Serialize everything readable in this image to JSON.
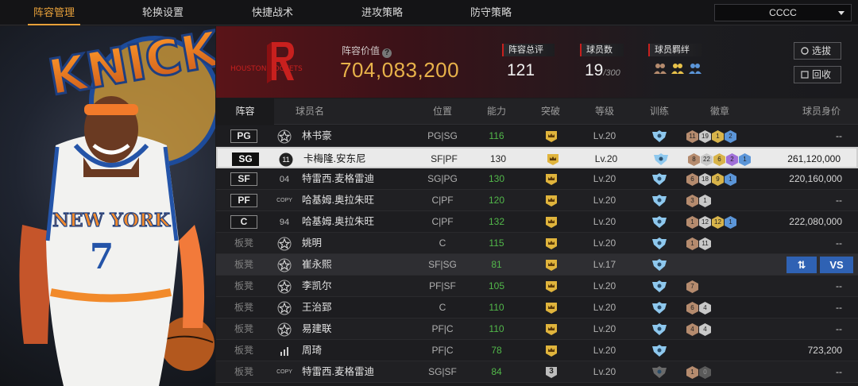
{
  "nav": {
    "tabs": [
      "阵容管理",
      "轮换设置",
      "快捷战术",
      "进攻策略",
      "防守策略"
    ],
    "active_tab": "阵容管理",
    "dropdown_value": "CCCC"
  },
  "team": {
    "logo_text": "HOUSTON ROCKETS",
    "value_label": "阵容价值",
    "value": "704,083,200",
    "rating_label": "阵容总评",
    "rating": "121",
    "players_label": "球员数",
    "players_count": "19",
    "players_max": "/300",
    "chem_label": "球员羁绊",
    "select_button": "选拔",
    "recycle_button": "回收"
  },
  "player_card": {
    "jersey_team": "NEW YORK",
    "jersey_number": "7",
    "bg_logo": "KNICKS"
  },
  "colors": {
    "accent": "#e8a13a",
    "value_gold": "#e8b24a",
    "red": "#c8201e",
    "blue_btn": "#2f62b4",
    "green_text": "#52b84a"
  },
  "table": {
    "headers": [
      "阵容",
      "球员名",
      "位置",
      "能力",
      "突破",
      "等级",
      "训练",
      "徽章",
      "球员身价"
    ],
    "rows": [
      {
        "slot": "PG",
        "type": "starter",
        "badge": "star-icon",
        "name": "林书豪",
        "position": "PG|SG",
        "rating": "116",
        "breakthrough": "crown",
        "level": "Lv.20",
        "medals": [
          [
            "b",
            "11"
          ],
          [
            "s",
            "19"
          ],
          [
            "g",
            "1"
          ],
          [
            "bl",
            "2"
          ]
        ],
        "price": "--"
      },
      {
        "slot": "SG",
        "type": "starter",
        "badge": "dark-circle-icon",
        "badge_text": "11",
        "name": "卡梅隆.安东尼",
        "position": "SF|PF",
        "rating": "130",
        "breakthrough": "crown",
        "level": "Lv.20",
        "medals": [
          [
            "b",
            "8"
          ],
          [
            "s",
            "22"
          ],
          [
            "g",
            "6"
          ],
          [
            "p",
            "2"
          ],
          [
            "bl",
            "1"
          ]
        ],
        "price": "261,120,000"
      },
      {
        "slot": "SF",
        "type": "starter",
        "badge": "year-04",
        "badge_text": "04",
        "name": "特雷西.麦格雷迪",
        "position": "SG|PG",
        "rating": "130",
        "breakthrough": "crown",
        "level": "Lv.20",
        "medals": [
          [
            "b",
            "6"
          ],
          [
            "s",
            "18"
          ],
          [
            "g",
            "9"
          ],
          [
            "bl",
            "1"
          ]
        ],
        "price": "220,160,000"
      },
      {
        "slot": "PF",
        "type": "starter",
        "badge": "copy",
        "badge_text": "COPY",
        "name": "哈基姆.奥拉朱旺",
        "position": "C|PF",
        "rating": "120",
        "breakthrough": "crown",
        "level": "Lv.20",
        "medals": [
          [
            "b",
            "3"
          ],
          [
            "s",
            "1"
          ]
        ],
        "price": "--"
      },
      {
        "slot": "C",
        "type": "starter",
        "badge": "year-94",
        "badge_text": "94",
        "name": "哈基姆.奥拉朱旺",
        "position": "C|PF",
        "rating": "132",
        "breakthrough": "crown",
        "level": "Lv.20",
        "medals": [
          [
            "b",
            "1"
          ],
          [
            "s",
            "12"
          ],
          [
            "g",
            "12"
          ],
          [
            "bl",
            "1"
          ]
        ],
        "price": "222,080,000"
      },
      {
        "slot": "板凳",
        "type": "bench",
        "badge": "star-icon",
        "name": "姚明",
        "position": "C",
        "rating": "115",
        "breakthrough": "crown",
        "level": "Lv.20",
        "medals": [
          [
            "b",
            "1"
          ],
          [
            "s",
            "11"
          ]
        ],
        "price": "--"
      },
      {
        "slot": "板凳",
        "type": "bench",
        "badge": "star-icon",
        "name": "崔永熙",
        "position": "SF|SG",
        "rating": "81",
        "breakthrough": "crown",
        "level": "Lv.17",
        "medals": [],
        "price": "",
        "actions": true
      },
      {
        "slot": "板凳",
        "type": "bench",
        "badge": "star-icon",
        "name": "李凯尔",
        "position": "PF|SF",
        "rating": "105",
        "breakthrough": "crown",
        "level": "Lv.20",
        "medals": [
          [
            "b",
            "7"
          ]
        ],
        "price": "--"
      },
      {
        "slot": "板凳",
        "type": "bench",
        "badge": "star-icon",
        "name": "王治郅",
        "position": "C",
        "rating": "110",
        "breakthrough": "crown",
        "level": "Lv.20",
        "medals": [
          [
            "b",
            "6"
          ],
          [
            "s",
            "4"
          ]
        ],
        "price": "--"
      },
      {
        "slot": "板凳",
        "type": "bench",
        "badge": "star-icon",
        "name": "易建联",
        "position": "PF|C",
        "rating": "110",
        "breakthrough": "crown",
        "level": "Lv.20",
        "medals": [
          [
            "b",
            "4"
          ],
          [
            "s",
            "4"
          ]
        ],
        "price": "--"
      },
      {
        "slot": "板凳",
        "type": "bench",
        "badge": "bars-icon",
        "name": "周琦",
        "position": "PF|C",
        "rating": "78",
        "breakthrough": "crown",
        "level": "Lv.20",
        "medals": [],
        "price": "723,200"
      },
      {
        "slot": "板凳",
        "type": "bench",
        "badge": "copy",
        "badge_text": "COPY",
        "name": "特雷西.麦格雷迪",
        "position": "SG|SF",
        "rating": "84",
        "breakthrough": "3",
        "level": "Lv.20",
        "medals": [
          [
            "b",
            "1"
          ],
          [
            "dk",
            "0"
          ]
        ],
        "price": "--",
        "train_dim": true
      }
    ],
    "actions": {
      "swap_label": "⇅",
      "vs_label": "VS"
    }
  }
}
